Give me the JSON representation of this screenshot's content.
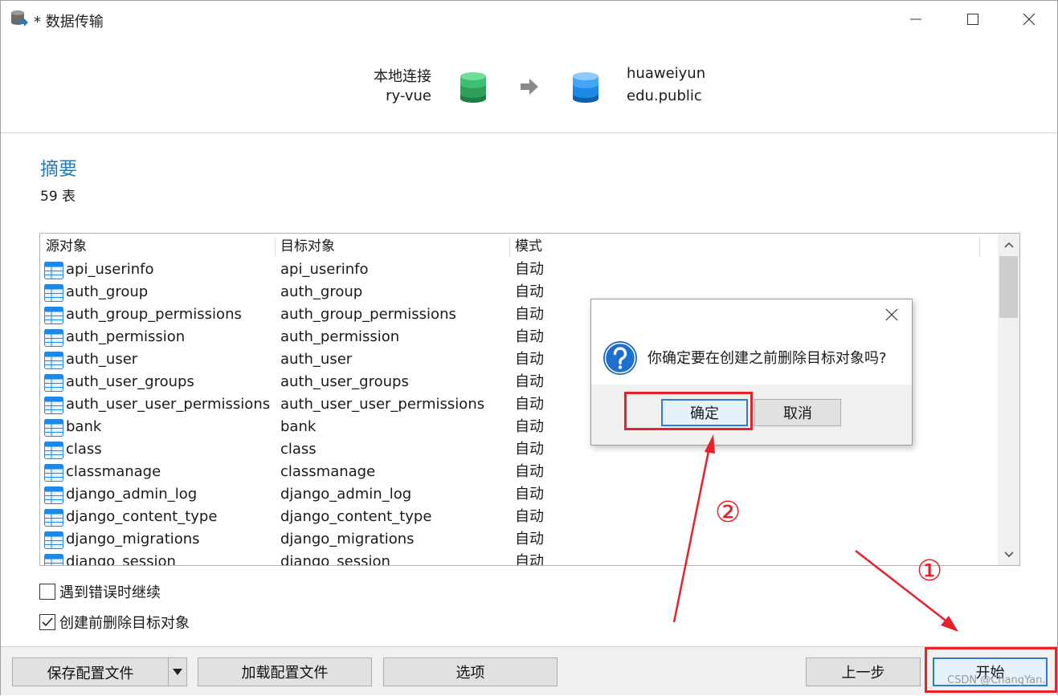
{
  "window": {
    "title": "* 数据传输"
  },
  "connection": {
    "source_name": "本地连接",
    "source_db": "ry-vue",
    "target_name": "huaweiyun",
    "target_db": "edu.public"
  },
  "summary": {
    "title": "摘要",
    "count": "59 表"
  },
  "table": {
    "columns": [
      "源对象",
      "目标对象",
      "模式"
    ],
    "rows": [
      [
        "api_userinfo",
        "api_userinfo",
        "自动"
      ],
      [
        "auth_group",
        "auth_group",
        "自动"
      ],
      [
        "auth_group_permissions",
        "auth_group_permissions",
        "自动"
      ],
      [
        "auth_permission",
        "auth_permission",
        "自动"
      ],
      [
        "auth_user",
        "auth_user",
        "自动"
      ],
      [
        "auth_user_groups",
        "auth_user_groups",
        "自动"
      ],
      [
        "auth_user_user_permissions",
        "auth_user_user_permissions",
        "自动"
      ],
      [
        "bank",
        "bank",
        "自动"
      ],
      [
        "class",
        "class",
        "自动"
      ],
      [
        "classmanage",
        "classmanage",
        "自动"
      ],
      [
        "django_admin_log",
        "django_admin_log",
        "自动"
      ],
      [
        "django_content_type",
        "django_content_type",
        "自动"
      ],
      [
        "django_migrations",
        "django_migrations",
        "自动"
      ],
      [
        "django_session",
        "django_session",
        "自动"
      ]
    ]
  },
  "options": {
    "continue_on_error": {
      "label": "遇到错误时继续",
      "checked": false
    },
    "drop_before_create": {
      "label": "创建前删除目标对象",
      "checked": true
    }
  },
  "buttons": {
    "save_profile": "保存配置文件",
    "load_profile": "加载配置文件",
    "options": "选项",
    "back": "上一步",
    "start": "开始"
  },
  "dialog": {
    "message": "你确定要在创建之前删除目标对象吗?",
    "ok": "确定",
    "cancel": "取消"
  },
  "annotations": {
    "step1": "①",
    "step2": "②",
    "color": "#e8202a"
  },
  "watermark": "CSDN @ChangYan.",
  "colors": {
    "accent": "#2a7ab8",
    "source_db": "#2e9e5b",
    "target_db": "#1e88e5",
    "focus": "#2f7ad8"
  },
  "icons": {
    "app": "data-transfer-icon",
    "source": "green-database-icon",
    "arrow": "arrow-right-icon",
    "target": "blue-database-icon",
    "dialog": "question-icon",
    "table": "table-icon"
  }
}
